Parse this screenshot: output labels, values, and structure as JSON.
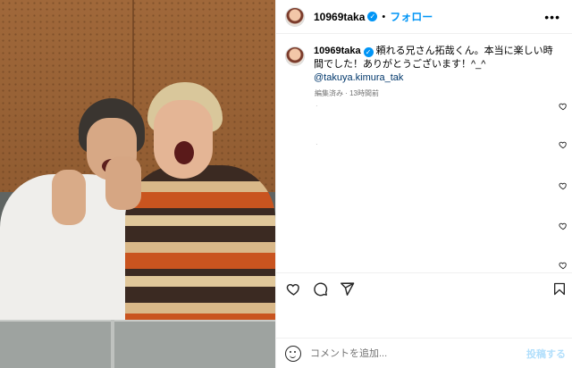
{
  "header": {
    "username": "10969taka",
    "separator": "•",
    "follow_label": "フォロー",
    "more_label": "•••"
  },
  "caption": {
    "username": "10969taka",
    "text": " 頼れる兄さん拓哉くん。本当に楽しい時間でした！ありがとうございます！^_^ ",
    "mention": "@takuya.kimura_tak",
    "meta": "編集済み · 13時間前"
  },
  "comments": [
    {
      "mark": "·"
    },
    {
      "mark": "·"
    },
    {
      "mark": ""
    },
    {
      "mark": ""
    },
    {
      "mark": ""
    }
  ],
  "actions": {
    "like_icon": "heart-icon",
    "comment_icon": "comment-icon",
    "share_icon": "share-icon",
    "save_icon": "bookmark-icon"
  },
  "add_comment": {
    "placeholder": "コメントを追加...",
    "post_label": "投稿する"
  },
  "colors": {
    "accent": "#0095f6",
    "mention": "#00376b",
    "muted": "#737373"
  }
}
